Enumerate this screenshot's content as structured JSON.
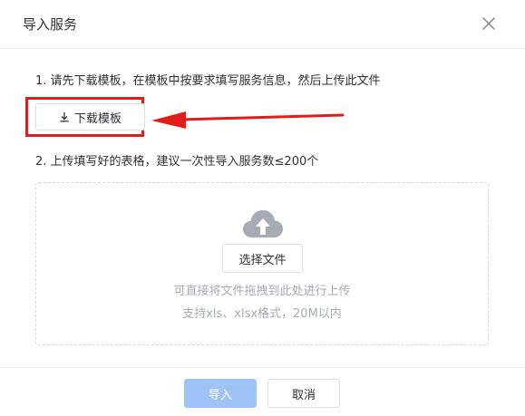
{
  "dialog": {
    "title": "导入服务",
    "close_icon": "close-icon"
  },
  "steps": {
    "step1_text": "1. 请先下载模板，在模板中按要求填写服务信息，然后上传此文件",
    "step2_text": "2. 上传填写好的表格，建议一次性导入服务数≤200个"
  },
  "download": {
    "label": "下载模板",
    "icon": "download-icon"
  },
  "annotation": {
    "box_color": "#e21b1b",
    "arrow_color": "#e21b1b"
  },
  "upload": {
    "icon": "cloud-upload-icon",
    "choose_label": "选择文件",
    "hint_line1": "可直接将文件拖拽到此处进行上传",
    "hint_line2": "支持xls、xlsx格式，20M以内"
  },
  "footer": {
    "import_label": "导入",
    "cancel_label": "取消",
    "import_color": "#a0c3f7"
  }
}
